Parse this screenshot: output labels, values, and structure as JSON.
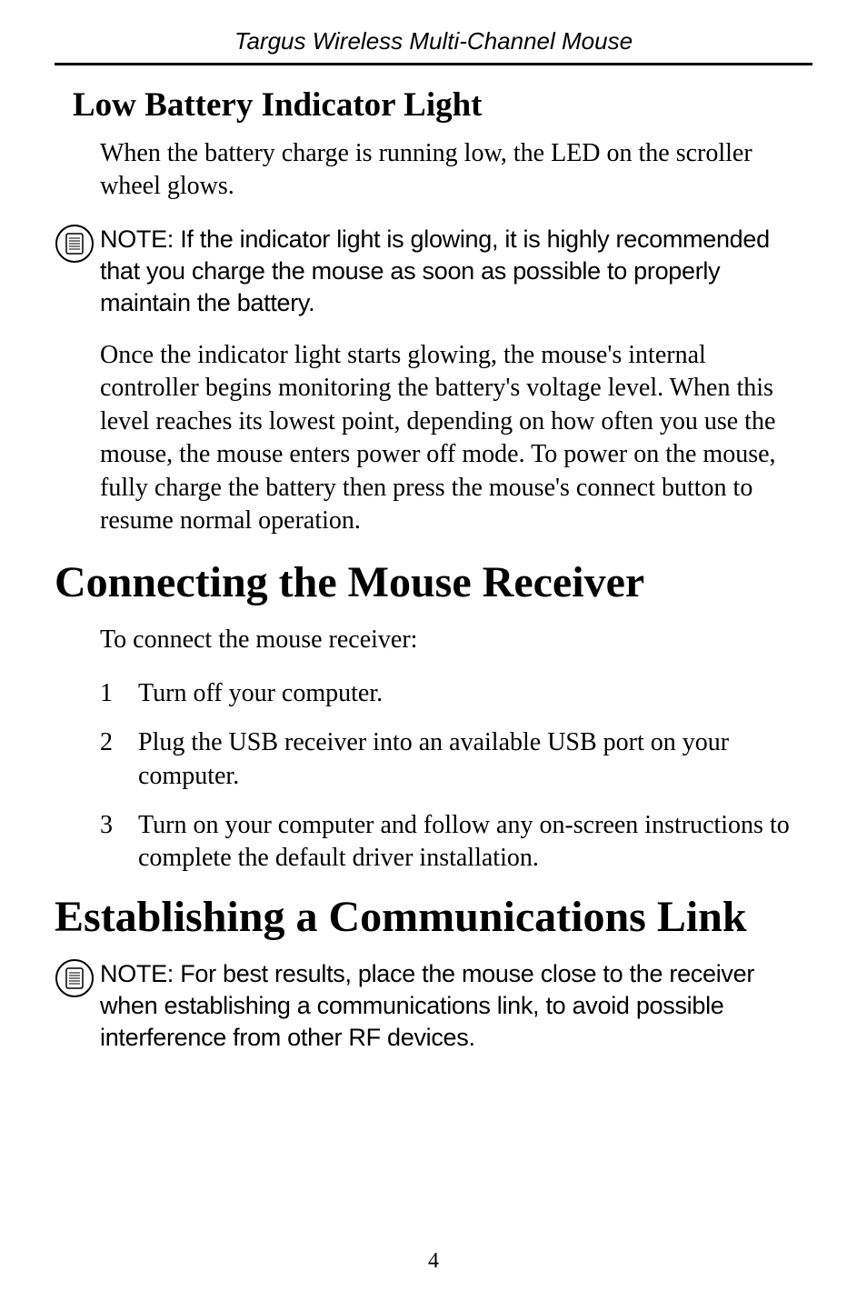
{
  "header": {
    "title": "Targus Wireless Multi-Channel Mouse"
  },
  "section_low_battery": {
    "heading": "Low Battery Indicator Light",
    "para1": "When the battery charge is running low, the LED on the scroller wheel glows.",
    "note": "NOTE: If the indicator light is glowing, it is highly recommended that you charge the mouse as soon as possible to properly maintain the battery.",
    "para2": "Once the indicator light starts glowing, the mouse's internal controller begins monitoring the battery's voltage level. When this level reaches its lowest point, depending on how often you use the mouse, the mouse enters power off mode. To power on the mouse, fully charge the battery then press the mouse's connect button to resume normal operation."
  },
  "section_connecting": {
    "heading": "Connecting the Mouse Receiver",
    "intro": "To connect the mouse receiver:",
    "steps": [
      {
        "num": "1",
        "text": "Turn off your computer."
      },
      {
        "num": "2",
        "text": "Plug the USB receiver into an available USB port on your computer."
      },
      {
        "num": "3",
        "text": "Turn on your computer and follow any on-screen instructions to complete the default driver installation."
      }
    ]
  },
  "section_establishing": {
    "heading": "Establishing a Communications Link",
    "note": "NOTE: For best results, place the mouse close to the receiver when establishing a communications link, to avoid possible interference from other RF devices."
  },
  "page_number": "4"
}
